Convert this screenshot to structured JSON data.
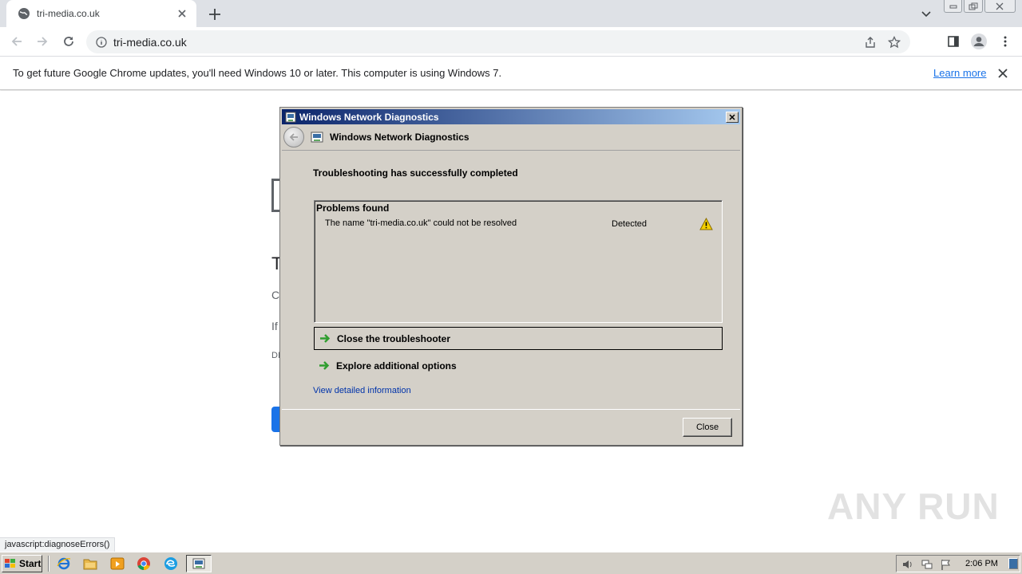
{
  "browser": {
    "tab_title": "tri-media.co.uk",
    "url": "tri-media.co.uk"
  },
  "infobar": {
    "message": "To get future Google Chrome updates, you'll need Windows 10 or later. This computer is using Windows 7.",
    "learn_more": "Learn more"
  },
  "page": {
    "title_fragment": "T",
    "line1_fragment": "C",
    "line2_fragment": "If",
    "line3_fragment": "DI"
  },
  "status_url": "javascript:diagnoseErrors()",
  "dialog": {
    "window_title": "Windows Network Diagnostics",
    "nav_title": "Windows Network Diagnostics",
    "heading": "Troubleshooting has successfully completed",
    "problems_header": "Problems found",
    "problems": [
      {
        "name": "The name \"tri-media.co.uk\" could not be resolved",
        "status": "Detected"
      }
    ],
    "options": [
      {
        "label": "Close the troubleshooter"
      },
      {
        "label": "Explore additional options"
      }
    ],
    "detail_link": "View detailed information",
    "close_label": "Close"
  },
  "taskbar": {
    "start_label": "Start",
    "clock": "2:06 PM"
  },
  "watermark": "ANY RUN",
  "colors": {
    "titlebar_start": "#0a246a",
    "titlebar_end": "#a6caf0",
    "link": "#1a73e8",
    "dialog_bg": "#d4d0c8"
  }
}
